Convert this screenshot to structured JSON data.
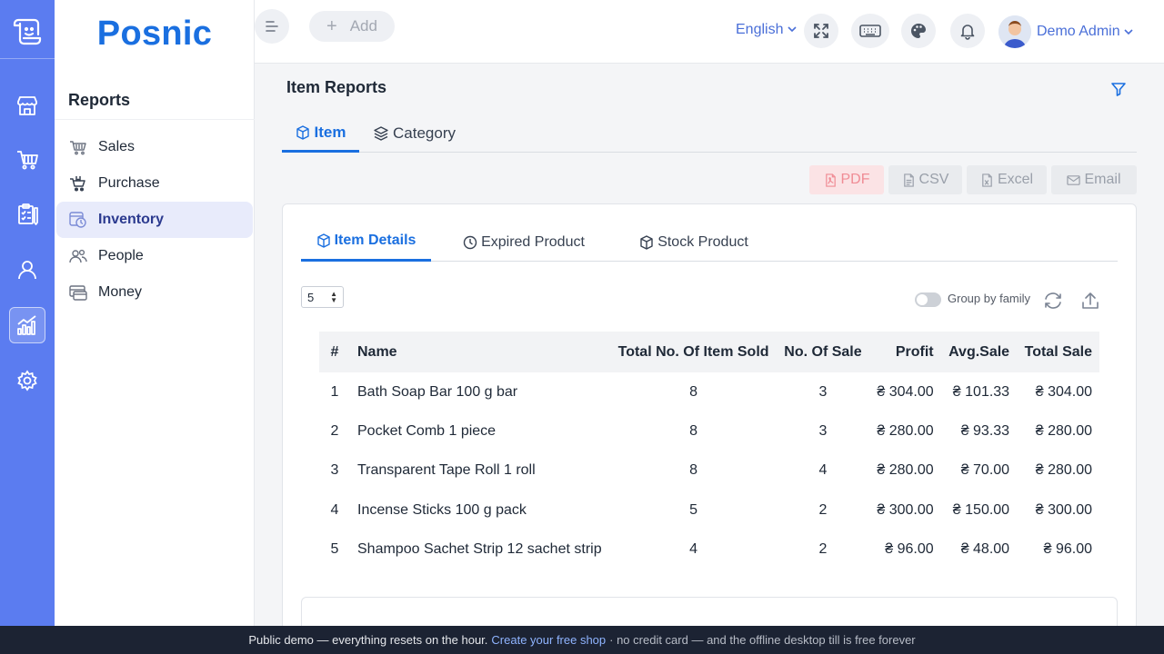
{
  "app": {
    "brand": "Posnic"
  },
  "rail": {
    "icons": [
      "app-logo-icon",
      "store-icon",
      "cart-icon",
      "clipboard-icon",
      "person-icon",
      "bar-chart-icon",
      "settings-icon"
    ],
    "active": "bar-chart-icon"
  },
  "sidebar": {
    "title": "Reports",
    "items": [
      {
        "label": "Sales",
        "icon": "basket-icon"
      },
      {
        "label": "Purchase",
        "icon": "cart-icon"
      },
      {
        "label": "Inventory",
        "icon": "inventory-icon",
        "active": true
      },
      {
        "label": "People",
        "icon": "people-icon"
      },
      {
        "label": "Money",
        "icon": "money-icon"
      }
    ]
  },
  "header": {
    "add_label": "Add",
    "language": "English",
    "user_name": "Demo Admin"
  },
  "main": {
    "title": "Item Reports",
    "tabs": [
      {
        "label": "Item",
        "active": true
      },
      {
        "label": "Category"
      }
    ],
    "exports": [
      "PDF",
      "CSV",
      "Excel",
      "Email"
    ]
  },
  "card": {
    "tabs": [
      {
        "label": "Item Details",
        "active": true
      },
      {
        "label": "Expired Product"
      },
      {
        "label": "Stock Product"
      }
    ],
    "page_size": "5",
    "group_toggle_label": "Group by family",
    "group_toggle_on": false
  },
  "table": {
    "columns": [
      "#",
      "Name",
      "Total No. Of Item Sold",
      "No. Of Sale",
      "Profit",
      "Avg.Sale",
      "Total Sale"
    ],
    "rows": [
      [
        "1",
        "Bath Soap Bar 100 g bar",
        "8",
        "3",
        "₴ 304.00",
        "₴ 101.33",
        "₴ 304.00"
      ],
      [
        "2",
        "Pocket Comb 1 piece",
        "8",
        "3",
        "₴ 280.00",
        "₴ 93.33",
        "₴ 280.00"
      ],
      [
        "3",
        "Transparent Tape Roll 1 roll",
        "8",
        "4",
        "₴ 280.00",
        "₴ 70.00",
        "₴ 280.00"
      ],
      [
        "4",
        "Incense Sticks 100 g pack",
        "5",
        "2",
        "₴ 300.00",
        "₴ 150.00",
        "₴ 300.00"
      ],
      [
        "5",
        "Shampoo Sachet Strip 12 sachet strip",
        "4",
        "2",
        "₴ 96.00",
        "₴ 48.00",
        "₴ 96.00"
      ]
    ]
  },
  "footer": {
    "lead": "Public demo — everything resets on the hour.",
    "link": "Create your free shop",
    "tail": "· no credit card — and the offline desktop till is free forever"
  },
  "colors": {
    "rail": "#5b7cf0",
    "accent": "#1a6fe0",
    "footer_bg": "#1c2333"
  }
}
